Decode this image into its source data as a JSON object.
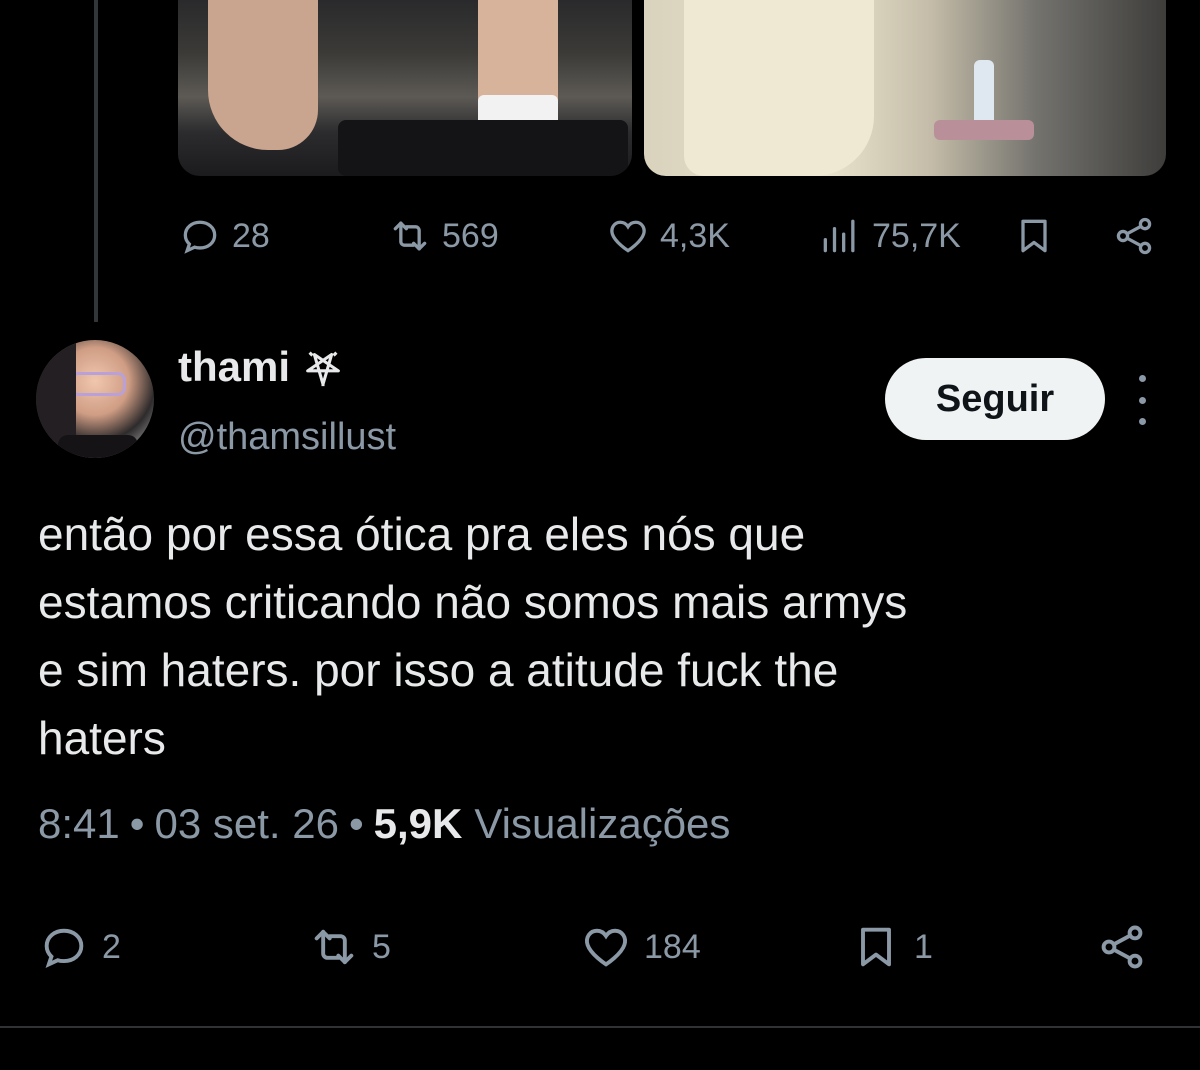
{
  "parent_tweet": {
    "stats": {
      "replies": "28",
      "retweets": "569",
      "likes": "4,3K",
      "views": "75,7K"
    },
    "icons": [
      "reply-icon",
      "retweet-icon",
      "like-icon",
      "views-icon",
      "bookmark-icon",
      "share-icon"
    ]
  },
  "reply": {
    "author": {
      "name": "thami",
      "handle": "@thamsillust",
      "badge_icon": "pentagram-icon"
    },
    "follow_label": "Seguir",
    "text": "então por essa ótica pra eles nós que\nestamos criticando não somos mais armys\ne sim haters. por isso a atitude fuck the\nhaters",
    "time": "8:41",
    "date": "03 set. 26",
    "separator": "•",
    "views_count": "5,9K",
    "views_label": "Visualizações",
    "actions": {
      "replies": "2",
      "retweets": "5",
      "likes": "184",
      "bookmarks": "1"
    }
  },
  "colors": {
    "background": "#000000",
    "text_primary": "#e7e9ea",
    "text_secondary": "#8b98a5",
    "button_bg": "#eff3f4",
    "button_text": "#0f1419",
    "divider": "#2f3336"
  }
}
